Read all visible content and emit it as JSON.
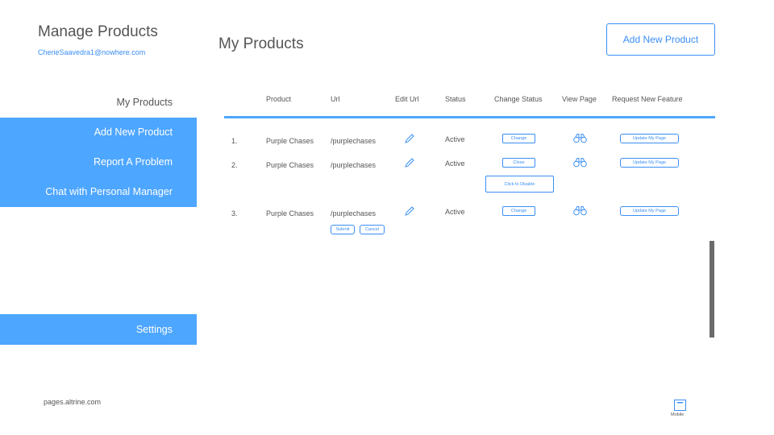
{
  "app": {
    "title": "Manage Products",
    "user_email": "CherieSaavedra1@nowhere.com",
    "footer_link": "pages.altrine.com"
  },
  "header": {
    "page_title": "My Products",
    "add_button": "Add New Product"
  },
  "sidebar": {
    "items": [
      {
        "label": "My Products"
      },
      {
        "label": "Add New Product"
      },
      {
        "label": "Report A Problem"
      },
      {
        "label": "Chat with Personal Manager"
      },
      {
        "label": "Settings"
      }
    ]
  },
  "table": {
    "columns": [
      "Product",
      "Url",
      "Edit Url",
      "Status",
      "Change Status",
      "View Page",
      "Request New Feature"
    ],
    "rows": [
      {
        "index": "1.",
        "product": "Purple Chases",
        "url": "/purplechases",
        "status": "Active",
        "change_btn": "Change",
        "feature_btn": "Update My Page"
      },
      {
        "index": "2.",
        "product": "Purple Chases",
        "url": "/purplechases",
        "status": "Active",
        "change_btn": "Close",
        "extra_btn": "Click to Disable",
        "feature_btn": "Update My Page"
      },
      {
        "index": "3.",
        "product": "Purple Chases",
        "url": "/purplechases",
        "status": "Active",
        "change_btn": "Change",
        "feature_btn": "Update My Page",
        "submit_btn": "Submit",
        "cancel_btn": "Cancel"
      }
    ]
  },
  "footer": {
    "mobile_label": "Mobile"
  },
  "colors": {
    "accent": "#3a8ef5",
    "sidebar_blue": "#4da6ff",
    "scrollbar": "#6b6b6b"
  }
}
